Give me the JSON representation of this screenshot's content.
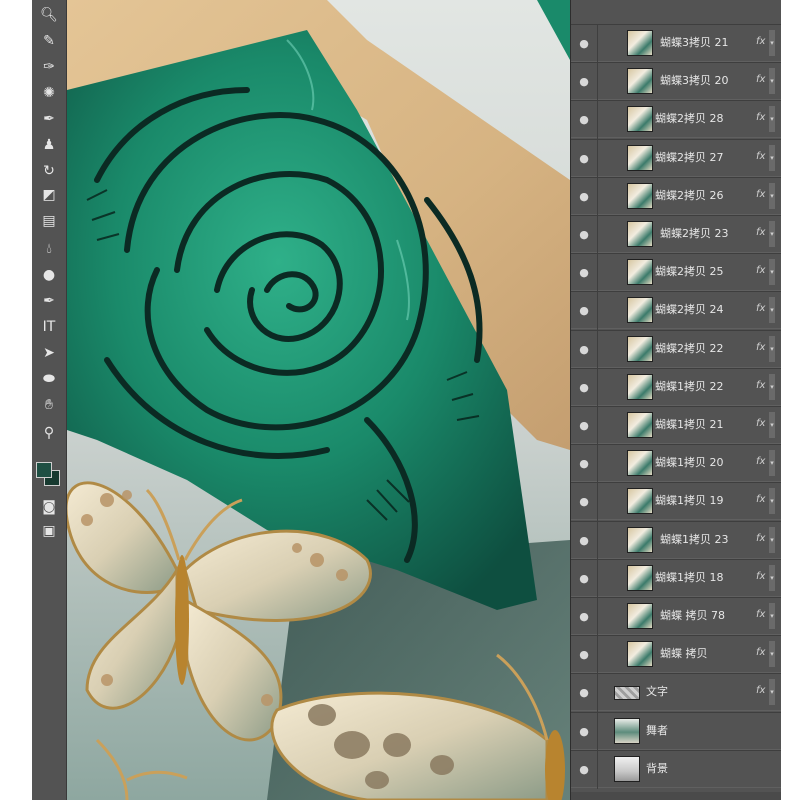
{
  "tools": [
    {
      "id": "zoom-top",
      "icon": "🔍︎"
    },
    {
      "id": "brush-heal",
      "icon": "✎"
    },
    {
      "id": "eyedropper",
      "icon": "✑"
    },
    {
      "id": "spot-heal",
      "icon": "✺"
    },
    {
      "id": "brush",
      "icon": "✒"
    },
    {
      "id": "stamp",
      "icon": "♟"
    },
    {
      "id": "history-brush",
      "icon": "↻"
    },
    {
      "id": "eraser",
      "icon": "◩"
    },
    {
      "id": "gradient",
      "icon": "▤"
    },
    {
      "id": "blur",
      "icon": "💧︎"
    },
    {
      "id": "dodge",
      "icon": "●"
    },
    {
      "id": "pen",
      "icon": "✒"
    },
    {
      "id": "type",
      "icon": "IT"
    },
    {
      "id": "path-select",
      "icon": "➤"
    },
    {
      "id": "ellipse",
      "icon": "⬬"
    },
    {
      "id": "hand",
      "icon": "✋︎"
    },
    {
      "id": "zoom",
      "icon": "⚲"
    },
    {
      "id": "quick-mask",
      "icon": "◙"
    },
    {
      "id": "screen-mode",
      "icon": "▣"
    }
  ],
  "layers": [
    {
      "name": "蝴蝶3拷贝 21",
      "fx": "fx",
      "thumb": "layer"
    },
    {
      "name": "蝴蝶3拷贝 20",
      "fx": "fx",
      "thumb": "layer"
    },
    {
      "name": "蝴蝶2拷贝 28",
      "fx": "fx",
      "thumb": "layer"
    },
    {
      "name": "蝴蝶2拷贝 27",
      "fx": "fx",
      "thumb": "layer"
    },
    {
      "name": "蝴蝶2拷贝 26",
      "fx": "fx",
      "thumb": "layer"
    },
    {
      "name": "蝴蝶2拷贝 23",
      "fx": "fx",
      "thumb": "layer"
    },
    {
      "name": "蝴蝶2拷贝 25",
      "fx": "fx",
      "thumb": "layer"
    },
    {
      "name": "蝴蝶2拷贝 24",
      "fx": "fx",
      "thumb": "layer"
    },
    {
      "name": "蝴蝶2拷贝 22",
      "fx": "fx",
      "thumb": "layer"
    },
    {
      "name": "蝴蝶1拷贝 22",
      "fx": "fx",
      "thumb": "layer"
    },
    {
      "name": "蝴蝶1拷贝 21",
      "fx": "fx",
      "thumb": "layer"
    },
    {
      "name": "蝴蝶1拷贝 20",
      "fx": "fx",
      "thumb": "layer"
    },
    {
      "name": "蝴蝶1拷贝 19",
      "fx": "fx",
      "thumb": "layer"
    },
    {
      "name": "蝴蝶1拷贝 23",
      "fx": "fx",
      "thumb": "layer"
    },
    {
      "name": "蝴蝶1拷贝 18",
      "fx": "fx",
      "thumb": "layer"
    },
    {
      "name": "蝴蝶 拷贝 78",
      "fx": "fx",
      "thumb": "layer"
    },
    {
      "name": "蝴蝶 拷贝",
      "fx": "fx",
      "thumb": "layer"
    },
    {
      "name": "文字",
      "fx": "fx",
      "thumb": "text"
    },
    {
      "name": "舞者",
      "fx": "",
      "thumb": "figure"
    },
    {
      "name": "背景",
      "fx": "",
      "thumb": "background"
    }
  ],
  "colors": {
    "toolbar": "#535353",
    "panel": "#535353",
    "foreground_swatch": "#1e4f43",
    "background_swatch": "#173a30"
  }
}
